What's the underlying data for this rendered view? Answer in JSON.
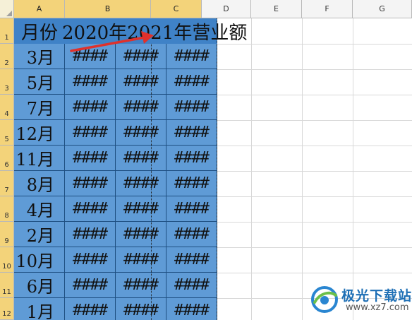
{
  "column_headers": [
    "A",
    "B",
    "C",
    "D",
    "E",
    "F",
    "G"
  ],
  "row_headers": [
    "1",
    "2",
    "3",
    "4",
    "5",
    "6",
    "7",
    "8",
    "9",
    "10",
    "11",
    "12"
  ],
  "header_row": {
    "month_label": "月份",
    "merged_text": "2020年2021年营业额"
  },
  "rows": [
    {
      "month": "3月",
      "b": "####",
      "c": "####",
      "d": "####"
    },
    {
      "month": "5月",
      "b": "####",
      "c": "####",
      "d": "####"
    },
    {
      "month": "7月",
      "b": "####",
      "c": "####",
      "d": "####"
    },
    {
      "month": "12月",
      "b": "####",
      "c": "####",
      "d": "####"
    },
    {
      "month": "11月",
      "b": "####",
      "c": "####",
      "d": "####"
    },
    {
      "month": "8月",
      "b": "####",
      "c": "####",
      "d": "####"
    },
    {
      "month": "4月",
      "b": "####",
      "c": "####",
      "d": "####"
    },
    {
      "month": "2月",
      "b": "####",
      "c": "####",
      "d": "####"
    },
    {
      "month": "10月",
      "b": "####",
      "c": "####",
      "d": "####"
    },
    {
      "month": "6月",
      "b": "####",
      "c": "####",
      "d": "####"
    },
    {
      "month": "1月",
      "b": "####",
      "c": "####",
      "d": "####"
    }
  ],
  "colors": {
    "selection_fill": "#5f9bd6",
    "header_fill": "#3f82c7",
    "arrow": "#e0312b",
    "selected_header": "#f3d37a"
  },
  "watermark": {
    "title": "极光下载站",
    "url": "www.xz7.com"
  }
}
